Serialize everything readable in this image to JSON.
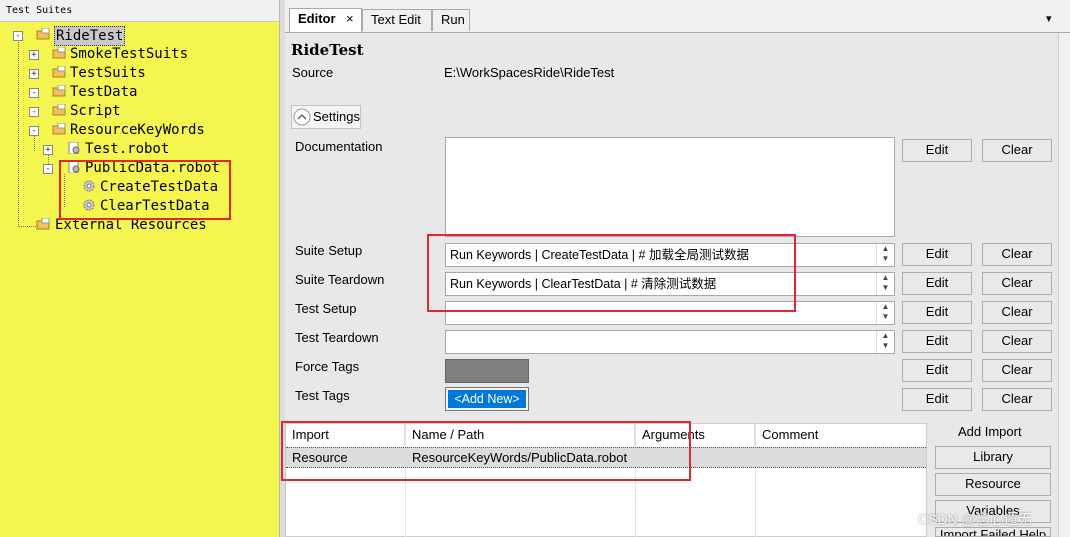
{
  "tree": {
    "header": "Test Suites",
    "nodes": [
      {
        "label": "RideTest",
        "expander": "-"
      },
      {
        "label": "SmokeTestSuits",
        "expander": "+"
      },
      {
        "label": "TestSuits",
        "expander": "+"
      },
      {
        "label": "TestData",
        "expander": "-"
      },
      {
        "label": "Script",
        "expander": "-"
      },
      {
        "label": "ResourceKeyWords",
        "expander": "-"
      },
      {
        "label": "Test.robot",
        "expander": "+"
      },
      {
        "label": "PublicData.robot",
        "expander": "-"
      },
      {
        "label": "CreateTestData",
        "expander": ""
      },
      {
        "label": "ClearTestData",
        "expander": ""
      },
      {
        "label": "External Resources",
        "expander": ""
      }
    ]
  },
  "tabs": [
    {
      "label": "Editor",
      "close": "×"
    },
    {
      "label": "Text Edit"
    },
    {
      "label": "Run"
    }
  ],
  "tab_menu_glyph": "▾",
  "editor": {
    "title": "RideTest",
    "source_label": "Source",
    "source_value": "E:\\WorkSpacesRide\\RideTest",
    "settings_toggle": "Settings",
    "rows": {
      "documentation": {
        "label": "Documentation",
        "value": ""
      },
      "suite_setup": {
        "label": "Suite Setup",
        "value": "Run Keywords | CreateTestData | # 加载全局测试数据"
      },
      "suite_teardown": {
        "label": "Suite Teardown",
        "value": "Run Keywords | ClearTestData | # 清除测试数据"
      },
      "test_setup": {
        "label": "Test Setup",
        "value": ""
      },
      "test_teardown": {
        "label": "Test Teardown",
        "value": ""
      },
      "force_tags": {
        "label": "Force Tags"
      },
      "test_tags": {
        "label": "Test Tags",
        "add_new": "<Add New>"
      }
    },
    "edit_label": "Edit",
    "clear_label": "Clear"
  },
  "imports": {
    "columns": [
      "Import",
      "Name / Path",
      "Arguments",
      "Comment"
    ],
    "rows": [
      {
        "import": "Resource",
        "path": "ResourceKeyWords/PublicData.robot",
        "arguments": "",
        "comment": ""
      }
    ],
    "side_label": "Add Import",
    "buttons": [
      "Library",
      "Resource",
      "Variables",
      "Import Failed Help"
    ]
  },
  "watermark": "CSDN @忘心遁无",
  "colors": {
    "tree_bg": "#f5f550",
    "highlight_box": "#e0282e",
    "selection": "#0078d7"
  }
}
